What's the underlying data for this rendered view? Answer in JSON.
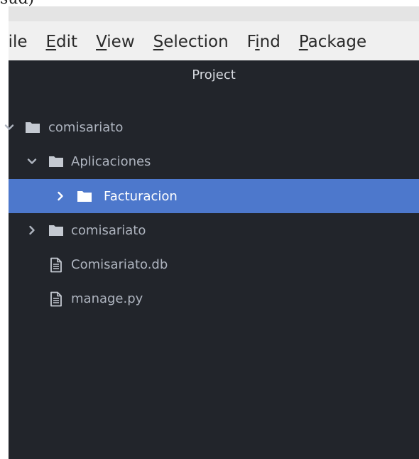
{
  "top_fragment": "sud)",
  "menubar": {
    "items": [
      {
        "pre": "",
        "mnemonic": "F",
        "post": "ile"
      },
      {
        "pre": "",
        "mnemonic": "E",
        "post": "dit"
      },
      {
        "pre": "",
        "mnemonic": "V",
        "post": "iew"
      },
      {
        "pre": "",
        "mnemonic": "S",
        "post": "election"
      },
      {
        "pre": "F",
        "mnemonic": "i",
        "post": "nd"
      },
      {
        "pre": "",
        "mnemonic": "P",
        "post": "ackage"
      }
    ]
  },
  "tree": {
    "title": "Project",
    "items": [
      {
        "label": "comisariato",
        "type": "folder",
        "state": "expanded"
      },
      {
        "label": "Aplicaciones",
        "type": "folder",
        "state": "expanded"
      },
      {
        "label": "Facturacion",
        "type": "folder",
        "state": "collapsed",
        "selected": true
      },
      {
        "label": "comisariato",
        "type": "folder",
        "state": "collapsed"
      },
      {
        "label": "Comisariato.db",
        "type": "file"
      },
      {
        "label": "manage.py",
        "type": "file"
      }
    ]
  },
  "colors": {
    "panel_bg": "#22252b",
    "selection": "#4d78cc",
    "text": "#aeb4bf",
    "menubar_bg": "#f0f0f0"
  }
}
